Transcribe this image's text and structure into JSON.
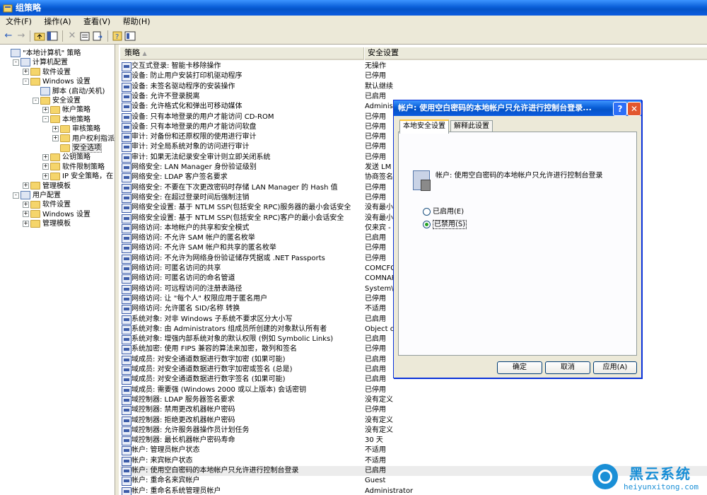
{
  "window": {
    "title": "组策略"
  },
  "menu": [
    "文件(F)",
    "操作(A)",
    "查看(V)",
    "帮助(H)"
  ],
  "toolbar_icons": [
    "back-arrow-icon",
    "forward-arrow-icon",
    "up-folder-icon",
    "show-hide-tree-icon",
    "delete-icon",
    "properties-icon",
    "export-list-icon",
    "help-icon",
    "console-tree-icon"
  ],
  "tree": [
    {
      "label": "\"本地计算机\" 策略",
      "level": 0,
      "icon": "computer"
    },
    {
      "label": "计算机配置",
      "level": 1,
      "exp": "-",
      "icon": "computer"
    },
    {
      "label": "软件设置",
      "level": 2,
      "exp": "+",
      "icon": "folder"
    },
    {
      "label": "Windows 设置",
      "level": 2,
      "exp": "-",
      "icon": "folder"
    },
    {
      "label": "脚本 (启动/关机)",
      "level": 3,
      "icon": "script"
    },
    {
      "label": "安全设置",
      "level": 3,
      "exp": "-",
      "icon": "folder"
    },
    {
      "label": "帐户策略",
      "level": 4,
      "exp": "+",
      "icon": "folder"
    },
    {
      "label": "本地策略",
      "level": 4,
      "exp": "-",
      "icon": "folder"
    },
    {
      "label": "审核策略",
      "level": 5,
      "exp": "+",
      "icon": "folder"
    },
    {
      "label": "用户权利指派",
      "level": 5,
      "exp": "+",
      "icon": "folder"
    },
    {
      "label": "安全选项",
      "level": 5,
      "icon": "folder",
      "selected": true
    },
    {
      "label": "公钥策略",
      "level": 4,
      "exp": "+",
      "icon": "folder"
    },
    {
      "label": "软件限制策略",
      "level": 4,
      "exp": "+",
      "icon": "folder"
    },
    {
      "label": "IP 安全策略，在",
      "level": 4,
      "exp": "+",
      "icon": "folder"
    },
    {
      "label": "管理模板",
      "level": 2,
      "exp": "+",
      "icon": "folder"
    },
    {
      "label": "用户配置",
      "level": 1,
      "exp": "-",
      "icon": "computer"
    },
    {
      "label": "软件设置",
      "level": 2,
      "exp": "+",
      "icon": "folder"
    },
    {
      "label": "Windows 设置",
      "level": 2,
      "exp": "+",
      "icon": "folder"
    },
    {
      "label": "管理模板",
      "level": 2,
      "exp": "+",
      "icon": "folder"
    }
  ],
  "list": {
    "columns": [
      "策略",
      "安全设置"
    ],
    "rows": [
      [
        "交互式登录: 智能卡移除操作",
        "无操作"
      ],
      [
        "设备: 防止用户安装打印机驱动程序",
        "已停用"
      ],
      [
        "设备: 未签名驱动程序的安装操作",
        "默认继续"
      ],
      [
        "设备: 允许不登录脱离",
        "已启用"
      ],
      [
        "设备: 允许格式化和弹出可移动媒体",
        "Administ"
      ],
      [
        "设备: 只有本地登录的用户才能访问 CD-ROM",
        "已停用"
      ],
      [
        "设备: 只有本地登录的用户才能访问软盘",
        "已停用"
      ],
      [
        "审计: 对备份和还原权限的使用进行审计",
        "已停用"
      ],
      [
        "审计: 对全局系统对象的访问进行审计",
        "已停用"
      ],
      [
        "审计: 如果无法纪录安全审计则立即关闭系统",
        "已停用"
      ],
      [
        "网络安全: LAN Manager 身份验证级别",
        "发送 LM"
      ],
      [
        "网络安全: LDAP 客户签名要求",
        "协商签名"
      ],
      [
        "网络安全: 不要在下次更改密码时存储 LAN Manager 的 Hash 值",
        "已停用"
      ],
      [
        "网络安全: 在超过登录时间后强制注销",
        "已停用"
      ],
      [
        "网络安全设置: 基于 NTLM SSP(包括安全 RPC)服务器的最小会话安全",
        "没有最小"
      ],
      [
        "网络安全设置: 基于 NTLM SSP(包括安全 RPC)客户的最小会话安全",
        "没有最小"
      ],
      [
        "网络访问: 本地帐户的共享和安全模式",
        "仅来宾 -"
      ],
      [
        "网络访问: 不允许 SAM 帐户的匿名枚举",
        "已启用"
      ],
      [
        "网络访问: 不允许 SAM 帐户和共享的匿名枚举",
        "已停用"
      ],
      [
        "网络访问: 不允许为网络身份验证储存凭据或 .NET Passports",
        "已停用"
      ],
      [
        "网络访问: 可匿名访问的共享",
        "COMCFG,D"
      ],
      [
        "网络访问: 可匿名访问的命名管道",
        "COMNAP,C"
      ],
      [
        "网络访问: 可远程访问的注册表路径",
        "System\\C"
      ],
      [
        "网络访问: 让 \"每个人\" 权限应用于匿名用户",
        "已停用"
      ],
      [
        "网络访问: 允许匿名 SID/名称 转换",
        "不适用"
      ],
      [
        "系统对象: 对非 Windows 子系统不要求区分大小写",
        "已启用"
      ],
      [
        "系统对象: 由 Administrators 组成员所创建的对象默认所有者",
        "Object c"
      ],
      [
        "系统对象: 增强内部系统对象的默认权限 (例如 Symbolic Links)",
        "已启用"
      ],
      [
        "系统加密: 使用 FIPS 兼容的算法来加密，散列和签名",
        "已停用"
      ],
      [
        "域成员: 对安全通道数据进行数字加密 (如果可能)",
        "已启用"
      ],
      [
        "域成员: 对安全通道数据进行数字加密或签名 (总是)",
        "已启用"
      ],
      [
        "域成员: 对安全通道数据进行数字签名 (如果可能)",
        "已启用"
      ],
      [
        "域成员: 需要强 (Windows 2000 或以上版本) 会话密钥",
        "已停用"
      ],
      [
        "域控制器: LDAP 服务器签名要求",
        "没有定义"
      ],
      [
        "域控制器: 禁用更改机器帐户密码",
        "已停用"
      ],
      [
        "域控制器: 拒绝更改机器帐户密码",
        "没有定义"
      ],
      [
        "域控制器: 允许服务器操作员计划任务",
        "没有定义"
      ],
      [
        "域控制器: 最长机器帐户密码寿命",
        "30 天"
      ],
      [
        "帐户: 管理员帐户状态",
        "不适用"
      ],
      [
        "帐户: 来宾帐户状态",
        "不适用"
      ],
      [
        "帐户: 使用空白密码的本地帐户只允许进行控制台登录",
        "已启用"
      ],
      [
        "帐户: 重命名来宾帐户",
        "Guest"
      ],
      [
        "帐户: 重命名系统管理员帐户",
        "Administrator"
      ]
    ],
    "selected_index": 40
  },
  "dialog": {
    "title": "帐户: 使用空白密码的本地帐户只允许进行控制台登录...",
    "help_label": "?",
    "close_label": "✕",
    "tabs": [
      "本地安全设置",
      "解释此设置"
    ],
    "policy_text": "帐户: 使用空白密码的本地帐户只允许进行控制台登录",
    "radio_enable": "已启用(E)",
    "radio_disable": "已禁用(S)",
    "selected_radio": "disable",
    "ok": "确定",
    "cancel": "取消",
    "apply": "应用(A)"
  },
  "watermark": {
    "title": "黑云系统",
    "url": "heiyunxitong.com"
  },
  "colors": {
    "titlebar": "#0a5fd8",
    "face": "#ece9d8",
    "accent": "#1a8fd6"
  }
}
